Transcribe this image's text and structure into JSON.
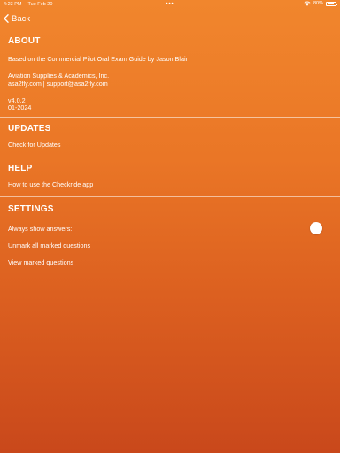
{
  "status_bar": {
    "time": "4:23 PM",
    "date": "Tue Feb 20",
    "dots": "•••",
    "battery": "80%",
    "battery_level": 0.8
  },
  "nav": {
    "back_label": "Back"
  },
  "about": {
    "title": "ABOUT",
    "based_on": "Based on the Commercial Pilot Oral Exam Guide by Jason Blair",
    "publisher": "Aviation Supplies & Academics, Inc.",
    "contact": "asa2fly.com | support@asa2fly.com",
    "version": "v4.0.2",
    "release": "01-2024"
  },
  "updates": {
    "title": "UPDATES",
    "check_label": "Check for Updates"
  },
  "help": {
    "title": "HELP",
    "howto_label": "How to use the Checkride app"
  },
  "settings": {
    "title": "SETTINGS",
    "always_show_label": "Always show answers:",
    "always_show_value": false,
    "unmark_label": "Unmark all marked questions",
    "view_marked_label": "View marked questions"
  }
}
